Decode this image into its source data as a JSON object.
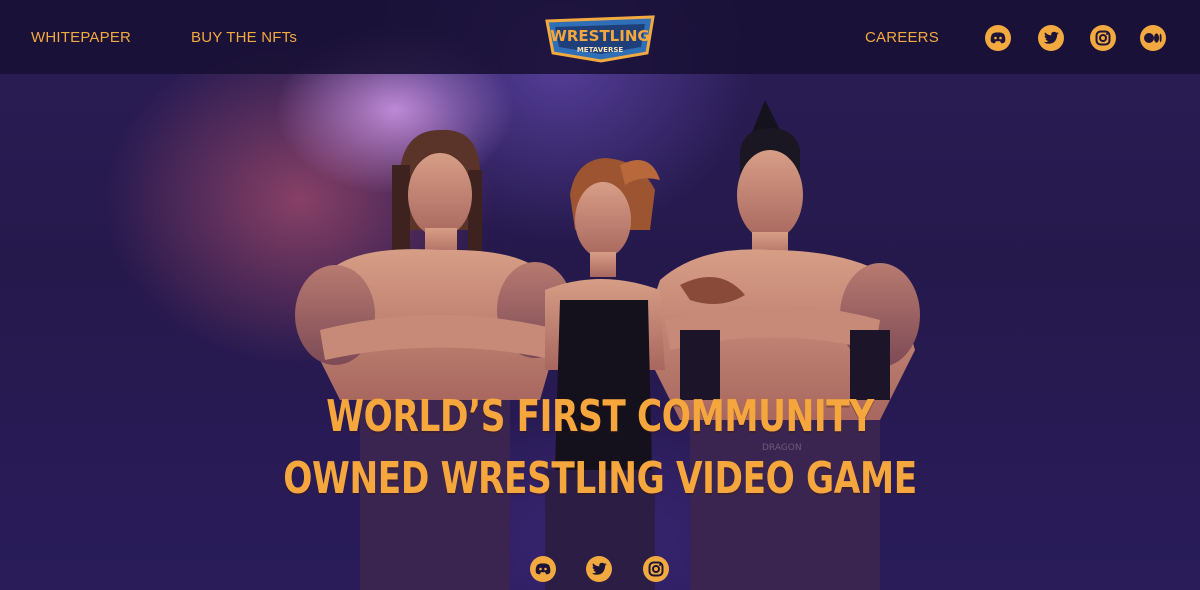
{
  "header": {
    "nav_left": [
      {
        "label": "WHITEPAPER"
      },
      {
        "label": "BUY THE NFTs"
      }
    ],
    "logo": {
      "line1": "WRESTLING",
      "line2": "METAVERSE"
    },
    "nav_right": [
      {
        "label": "CAREERS"
      }
    ],
    "socials": [
      {
        "icon": "discord-icon"
      },
      {
        "icon": "twitter-icon"
      },
      {
        "icon": "instagram-icon"
      },
      {
        "icon": "medium-icon"
      }
    ]
  },
  "hero": {
    "headline_line1": "WORLD’S FIRST COMMUNITY",
    "headline_line2": "OWNED WRESTLING VIDEO GAME",
    "belt_text": "DRAGON",
    "footer_socials": [
      {
        "icon": "discord-icon"
      },
      {
        "icon": "twitter-icon"
      },
      {
        "icon": "instagram-icon"
      }
    ]
  },
  "colors": {
    "accent": "#f2a93f",
    "header_bg": "#181034",
    "background": "#25194c"
  }
}
